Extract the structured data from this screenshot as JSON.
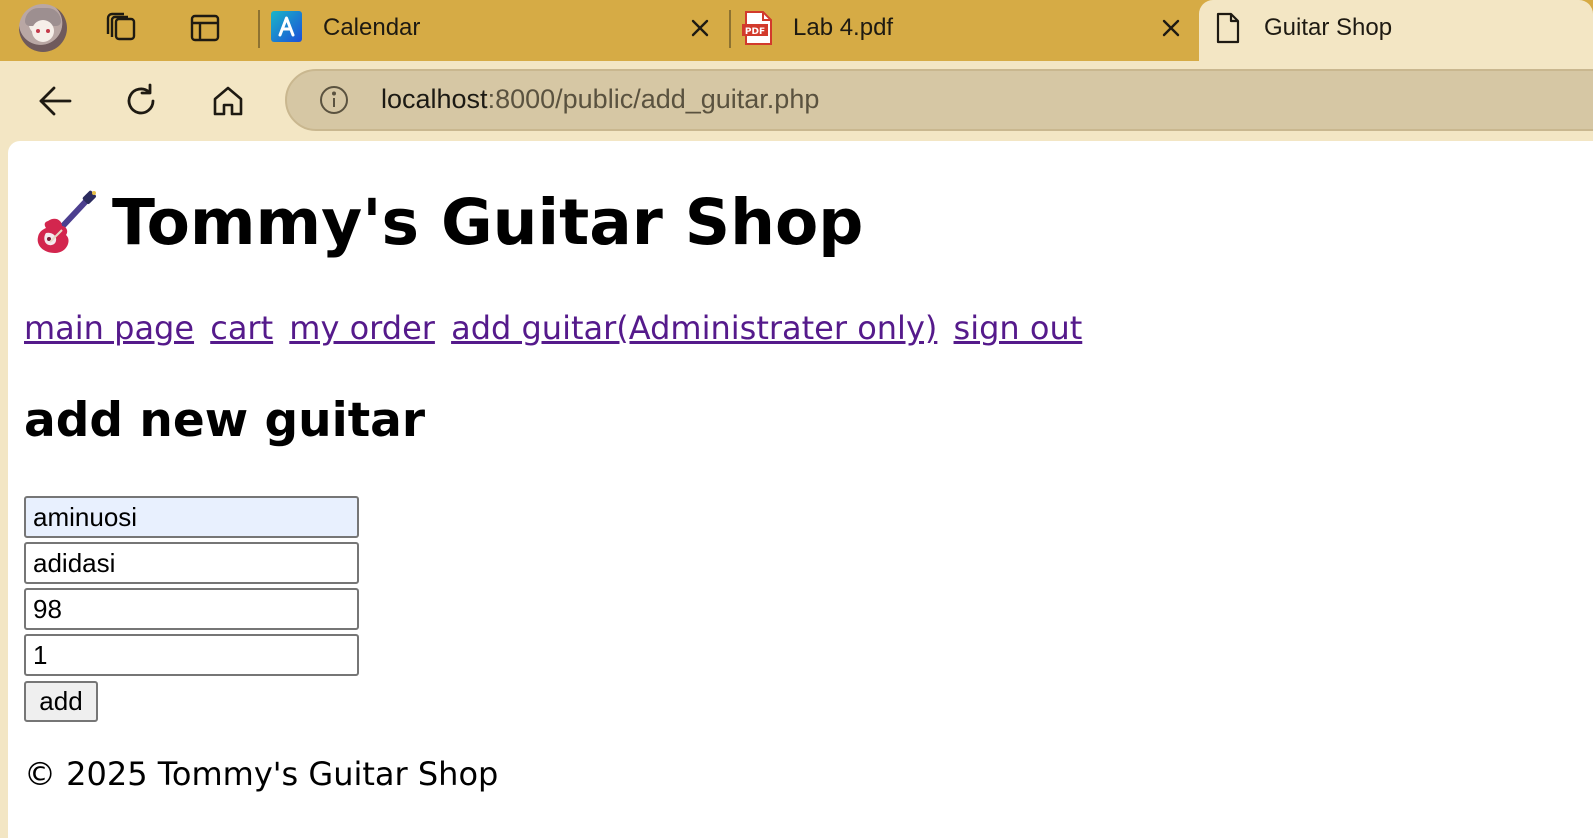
{
  "tabs": [
    {
      "title": "Calendar",
      "icon": "app-a-icon",
      "active": false
    },
    {
      "title": "Lab 4.pdf",
      "icon": "pdf-icon",
      "active": false
    },
    {
      "title": "Guitar Shop",
      "icon": "document-icon",
      "active": true
    }
  ],
  "address_bar": {
    "host": "localhost",
    "path": ":8000/public/add_guitar.php"
  },
  "page": {
    "title": "Tommy's Guitar Shop",
    "nav": [
      "main page",
      "cart",
      "my order",
      "add guitar(Administrater only)",
      "sign out"
    ],
    "section_title": "add new guitar",
    "form": {
      "fields": [
        "aminuosi",
        "adidasi",
        "98",
        "1"
      ],
      "submit_label": "add"
    },
    "footer": "© 2025 Tommy's Guitar Shop"
  },
  "colors": {
    "tabstrip": "#d6ab45",
    "toolbar": "#f3e6c4",
    "link_visited": "#551a8b",
    "autofill": "#e8f0fe"
  }
}
